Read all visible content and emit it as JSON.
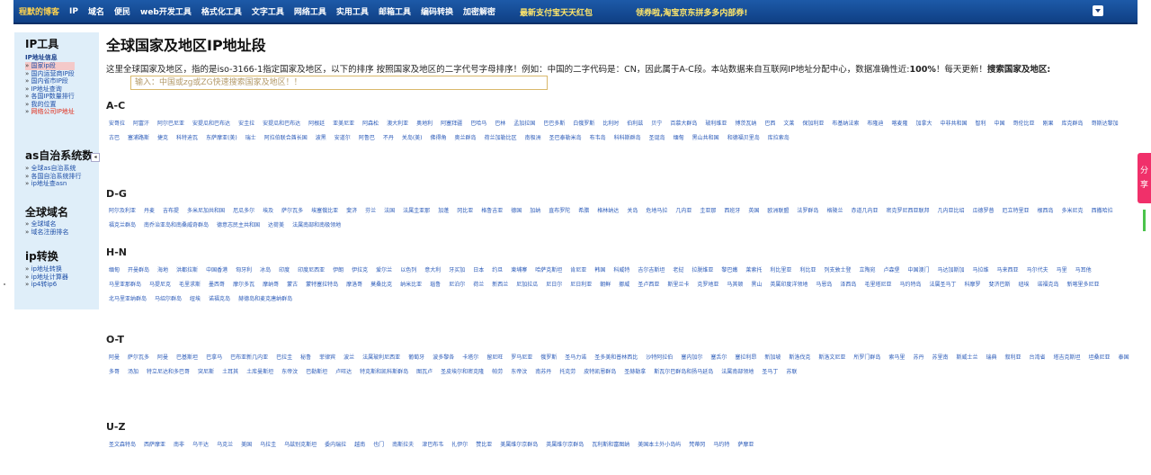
{
  "nav": {
    "items": [
      "程默的博客",
      "IP",
      "域名",
      "便民",
      "web开发工具",
      "格式化工具",
      "文字工具",
      "网络工具",
      "实用工具",
      "邮箱工具",
      "编码转换",
      "加密解密"
    ],
    "promo1": "最新支付宝天天红包",
    "promo2": "领券啦,淘宝京东拼多多内部券!"
  },
  "sidebar": {
    "sections": [
      {
        "title": "IP工具",
        "sub": "IP地址信息",
        "items": [
          "国家ip段",
          "国内运营商IP段",
          "国内省市IP段",
          "IP地址查询",
          "各国IP数量排行",
          "我的位置",
          "网络公司IP地址"
        ]
      },
      {
        "title": "as自治系统数",
        "items": [
          "全球as自治系统",
          "各国自治系统排行",
          "ip地址查asn"
        ]
      },
      {
        "title": "全球域名",
        "items": [
          "全球域名",
          "域名注册排名"
        ]
      },
      {
        "title": "ip转换",
        "items": [
          "ip地址转换",
          "ip地址计算器",
          "ip4转ip6"
        ]
      }
    ],
    "collapse_icon": "◂"
  },
  "main": {
    "title": "全球国家及地区IP地址段",
    "intro_1": "这里全球国家及地区，指的是iso-3166-1指定国家及地区，以下的排序 按照国家及地区的二字代号字母排序！例如：中国的二字代码是：CN，因此属于A-C段。本站数据来自互联网IP地址分配中心，数据准确性近:",
    "intro_percent": "100%",
    "intro_2": "！每天更新！",
    "intro_search": "搜索国家及地区:",
    "search_placeholder": "输入：中国或zg或ZG快速搜索国家及地区！！"
  },
  "groups": [
    {
      "title": "A-C",
      "links": [
        "安哥拉",
        "阿富汗",
        "阿尔巴尼亚",
        "安提瓜和巴布达",
        "安圭拉",
        "安提瓜和巴布达",
        "阿根廷",
        "亚美尼亚",
        "阿森松",
        "澳大利亚",
        "奥地利",
        "阿塞拜疆",
        "巴哈马",
        "巴林",
        "孟加拉国",
        "巴巴多斯",
        "白俄罗斯",
        "比利时",
        "伯利兹",
        "贝宁",
        "百慕大群岛",
        "玻利维亚",
        "博茨瓦纳",
        "巴西",
        "文莱",
        "保加利亚",
        "布基纳法索",
        "布隆迪",
        "喀麦隆",
        "加拿大",
        "中非共和国",
        "智利",
        "中国",
        "哥伦比亚",
        "刚果",
        "库克群岛",
        "哥斯达黎加",
        "古巴",
        "塞浦路斯",
        "捷克",
        "科特迪瓦",
        "东萨摩亚(美)",
        "瑞士",
        "阿拉伯联合酋长国",
        "波黑",
        "安道尔",
        "阿鲁巴",
        "不丹",
        "关岛(美)",
        "佛得角",
        "奥兰群岛",
        "荷兰加勒比区",
        "南极洲",
        "圣巴泰勒米岛",
        "布韦岛",
        "科科斯群岛",
        "圣诞岛",
        "缅甸",
        "黑山共和国",
        "和德福贝里岛",
        "库拉索岛"
      ]
    },
    {
      "title": "D-G",
      "links": [
        "阿尔及利亚",
        "丹麦",
        "吉布提",
        "多米尼加共和国",
        "厄瓜多尔",
        "埃及",
        "萨尔瓦多",
        "埃塞俄比亚",
        "斐济",
        "芬兰",
        "法国",
        "法属圭亚那",
        "加蓬",
        "冈比亚",
        "格鲁吉亚",
        "德国",
        "加纳",
        "直布罗陀",
        "希腊",
        "格林纳达",
        "关岛",
        "危地马拉",
        "几内亚",
        "圭亚那",
        "西班牙",
        "英国",
        "欧洲联盟",
        "法罗群岛",
        "格陵兰",
        "赤道几内亚",
        "密克罗尼西亚联邦",
        "几内亚比绍",
        "瓜德罗普",
        "厄立特里亚",
        "根西岛",
        "多米尼克",
        "西撒哈拉",
        "福克兰群岛",
        "南乔治亚岛和南桑威奇群岛",
        "德意志民主共和国",
        "达荷美",
        "法属南部和南极领地"
      ]
    },
    {
      "title": "H-N",
      "links": [
        "缅甸",
        "开曼群岛",
        "海地",
        "洪都拉斯",
        "中国香港",
        "匈牙利",
        "冰岛",
        "印度",
        "印度尼西亚",
        "伊朗",
        "伊拉克",
        "爱尔兰",
        "以色列",
        "意大利",
        "牙买加",
        "日本",
        "约旦",
        "柬埔寨",
        "哈萨克斯坦",
        "肯尼亚",
        "韩国",
        "科威特",
        "吉尔吉斯坦",
        "老挝",
        "拉脱维亚",
        "黎巴嫩",
        "莱索托",
        "利比里亚",
        "利比亚",
        "列支敦士登",
        "立陶宛",
        "卢森堡",
        "中国澳门",
        "马达加斯加",
        "马拉维",
        "马来西亚",
        "马尔代夫",
        "马里",
        "马耳他",
        "马里亚那群岛",
        "马提尼克",
        "毛里求斯",
        "墨西哥",
        "摩尔多瓦",
        "摩纳哥",
        "蒙古",
        "蒙特塞拉特岛",
        "摩洛哥",
        "莫桑比克",
        "纳米比亚",
        "瑙鲁",
        "尼泊尔",
        "荷兰",
        "新西兰",
        "尼加拉瓜",
        "尼日尔",
        "尼日利亚",
        "朝鲜",
        "挪威",
        "圣卢西亚",
        "斯里兰卡",
        "克罗地亚",
        "马其顿",
        "黑山",
        "英属印度洋领地",
        "马恩岛",
        "泽西岛",
        "毛里塔尼亚",
        "马约特岛",
        "法属圣马丁",
        "科摩罗",
        "斐济巴斯",
        "纽埃",
        "诺福克岛",
        "新喀里多尼亚",
        "北马里亚纳群岛",
        "马绍尔群岛",
        "纽埃",
        "诺福克岛",
        "赫德岛和麦克唐纳群岛"
      ]
    },
    {
      "title": "O-T",
      "links": [
        "阿曼",
        "萨尔瓦多",
        "阿曼",
        "巴基斯坦",
        "巴拿马",
        "巴布亚新几内亚",
        "巴拉圭",
        "秘鲁",
        "菲律宾",
        "波兰",
        "法属玻利尼西亚",
        "葡萄牙",
        "波多黎各",
        "卡塔尔",
        "留尼旺",
        "罗马尼亚",
        "俄罗斯",
        "圣马力诺",
        "圣多美和普林西比",
        "沙特阿拉伯",
        "塞内加尔",
        "塞舌尔",
        "塞拉利昂",
        "新加坡",
        "斯洛伐克",
        "斯洛文尼亚",
        "所罗门群岛",
        "索马里",
        "苏丹",
        "苏里南",
        "斯威士兰",
        "瑞典",
        "叙利亚",
        "台湾省",
        "塔吉克斯坦",
        "坦桑尼亚",
        "泰国",
        "多哥",
        "汤加",
        "特立尼达和多巴哥",
        "突尼斯",
        "土耳其",
        "土库曼斯坦",
        "东帝汶",
        "巴勒斯坦",
        "卢旺达",
        "特克斯和凯科斯群岛",
        "图瓦卢",
        "圣皮埃尔和密克隆",
        "帕劳",
        "东帝汶",
        "南苏丹",
        "托克劳",
        "皮特凯恩群岛",
        "圣赫勒拿",
        "斯瓦尔巴群岛和扬马延岛",
        "法属南部领地",
        "圣马丁",
        "苏联"
      ]
    },
    {
      "title": "U-Z",
      "links": [
        "圣文森特岛",
        "西萨摩亚",
        "南非",
        "乌干达",
        "乌克兰",
        "美国",
        "乌拉圭",
        "乌兹别克斯坦",
        "委内瑞拉",
        "越南",
        "也门",
        "南斯拉夫",
        "津巴布韦",
        "扎伊尔",
        "赞比亚",
        "美属维尔京群岛",
        "英属维尔京群岛",
        "瓦利斯和富图纳",
        "美国本土外小岛屿",
        "梵蒂冈",
        "马约特",
        "萨摩亚"
      ]
    }
  ],
  "share": {
    "label": "分享"
  }
}
